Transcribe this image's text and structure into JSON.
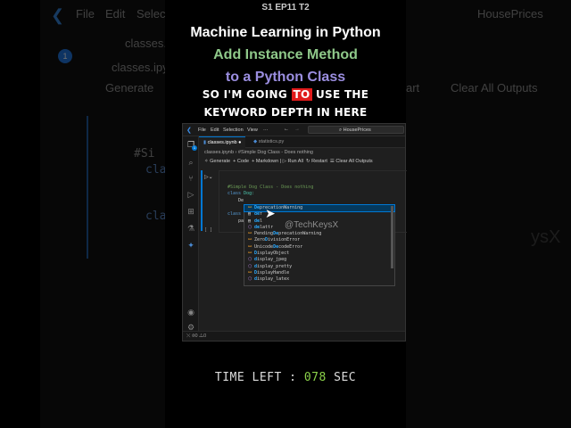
{
  "overlay": {
    "episode": "S1 EP11 T2",
    "title": "Machine Learning in Python",
    "subtitle_line1": "Add Instance Method",
    "subtitle_line2": "to a Python Class",
    "caption_line1_before": "SO I'M GOING ",
    "caption_highlight": "TO",
    "caption_line1_after": " USE THE",
    "caption_line2": "KEYWORD DEPTH IN HERE",
    "timer_label": "TIME LEFT : ",
    "timer_value": "078",
    "timer_unit": " SEC",
    "watermark": "@TechKeysX",
    "colors": {
      "green": "#8fc98a",
      "purple": "#9b8ee0",
      "highlight": "#e01b1b",
      "timer": "#8bd14a"
    }
  },
  "background": {
    "menu": [
      "File",
      "Edit",
      "Select"
    ],
    "tab": "classes.ipynb",
    "breadcrumb": "classes.ipyn",
    "generate": "Generate",
    "search": "HousePrices",
    "restart": "art",
    "clear": "Clear All Outputs",
    "code1": "#Si",
    "code2": "cla",
    "code3": "cla",
    "badge": "1",
    "watermark_part": "ysX"
  },
  "vscode": {
    "menu": [
      "File",
      "Edit",
      "Selection",
      "View",
      "···"
    ],
    "search": "HousePrices",
    "tabs": [
      {
        "label": "classes.ipynb",
        "active": true,
        "dirty": true
      },
      {
        "label": "statistics.py",
        "active": false
      }
    ],
    "breadcrumb": [
      "classes.ipynb",
      "#Simple Dog Class - Does nothing"
    ],
    "toolbar": [
      "Generate",
      "+ Code",
      "+ Markdown",
      "Run All",
      "Restart",
      "Clear All Outputs"
    ],
    "code": {
      "comment": "#Simple Dog Class - Does nothing",
      "line2_kw": "class",
      "line2_name": " Dog:",
      "line3": "De",
      "line4": "class",
      "line5": "pa",
      "cell_brackets": "[ ]"
    },
    "suggestions": [
      {
        "kind": "class",
        "label": "DeprecationWarning",
        "match": "De",
        "rest": "precationWarning"
      },
      {
        "kind": "keyword",
        "match": "de",
        "rest": "f"
      },
      {
        "kind": "keyword",
        "match": "de",
        "rest": "l"
      },
      {
        "kind": "function",
        "match": "de",
        "rest": "lattr"
      },
      {
        "kind": "class",
        "pre": "Pending",
        "match": "De",
        "rest": "precationWarning"
      },
      {
        "kind": "class",
        "pre": "Zero",
        "match": "D",
        "rest": "ivisionError"
      },
      {
        "kind": "class",
        "pre": "Unicode",
        "match": "De",
        "rest": "codeError"
      },
      {
        "kind": "class",
        "match": "D",
        "rest": "isplayObject"
      },
      {
        "kind": "function",
        "match": "d",
        "rest": "isplay_jpeg"
      },
      {
        "kind": "function",
        "match": "d",
        "rest": "isplay_pretty"
      },
      {
        "kind": "class",
        "match": "D",
        "rest": "isplayHandle"
      },
      {
        "kind": "function",
        "match": "d",
        "rest": "isplay_latex"
      }
    ],
    "status": {
      "errors": "0",
      "warnings": "0"
    },
    "badge": "1"
  }
}
